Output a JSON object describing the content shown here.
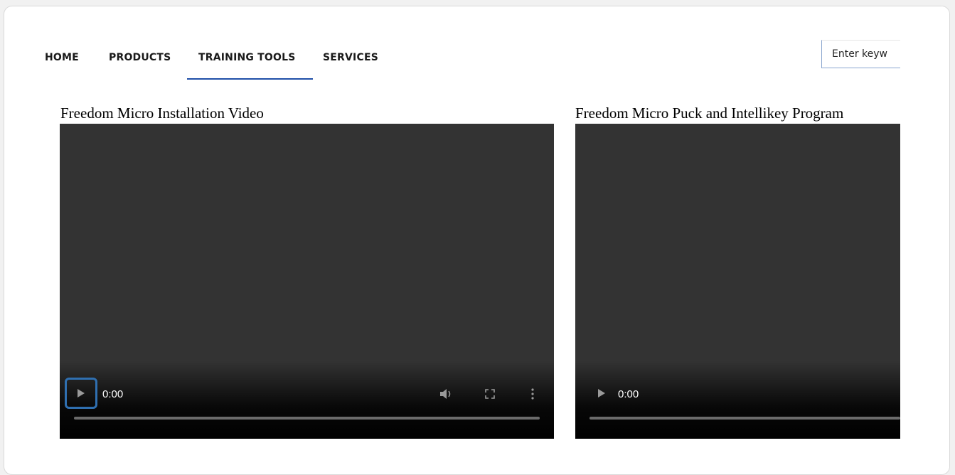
{
  "nav": {
    "items": [
      {
        "label": "HOME"
      },
      {
        "label": "PRODUCTS"
      },
      {
        "label": "TRAINING TOOLS",
        "active": true
      },
      {
        "label": "SERVICES"
      }
    ],
    "active_color": "#1f4fa8"
  },
  "search": {
    "placeholder": "Enter keyw"
  },
  "videos": [
    {
      "title": "Freedom Micro Installation Video",
      "time": "0:00",
      "controls": [
        "play-icon",
        "volume-icon",
        "fullscreen-icon",
        "more-options-icon"
      ]
    },
    {
      "title": "Freedom Micro Puck and Intellikey Program",
      "time": "0:00",
      "controls": [
        "play-icon"
      ]
    }
  ],
  "colors": {
    "player_bg": "#333333",
    "focus_ring": "#2f6fb0"
  }
}
